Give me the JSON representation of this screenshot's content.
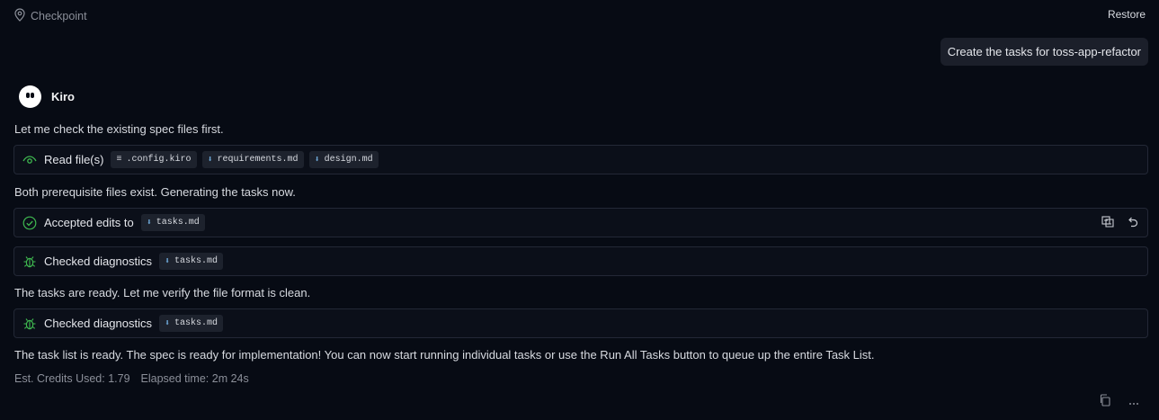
{
  "header": {
    "checkpoint_label": "Checkpoint",
    "restore_label": "Restore"
  },
  "user_message": "Create the tasks for toss-app-refactor",
  "agent": {
    "name": "Kiro"
  },
  "messages": {
    "m1": "Let me check the existing spec files first.",
    "m2": "Both prerequisite files exist. Generating the tasks now.",
    "m3": "The tasks are ready. Let me verify the file format is clean.",
    "m4": "The task list is ready. The spec is ready for implementation! You can now start running individual tasks or use the Run All Tasks button to queue up the entire Task List."
  },
  "actions": {
    "read": {
      "label": "Read file(s)",
      "files": [
        ".config.kiro",
        "requirements.md",
        "design.md"
      ]
    },
    "edits": {
      "label": "Accepted edits to",
      "file": "tasks.md"
    },
    "diag1": {
      "label": "Checked diagnostics",
      "file": "tasks.md"
    },
    "diag2": {
      "label": "Checked diagnostics",
      "file": "tasks.md"
    }
  },
  "footer": {
    "credits": "Est. Credits Used: 1.79",
    "elapsed": "Elapsed time: 2m 24s"
  },
  "colors": {
    "background": "#070b14",
    "accent_green": "#3fb950",
    "chip_icon_blue": "#6ea8d8"
  },
  "icons": [
    "location-pin-icon",
    "eye-icon",
    "check-circle-icon",
    "bug-icon",
    "compare-icon",
    "undo-icon",
    "copy-icon",
    "more-icon",
    "file-icon",
    "markdown-file-icon"
  ]
}
